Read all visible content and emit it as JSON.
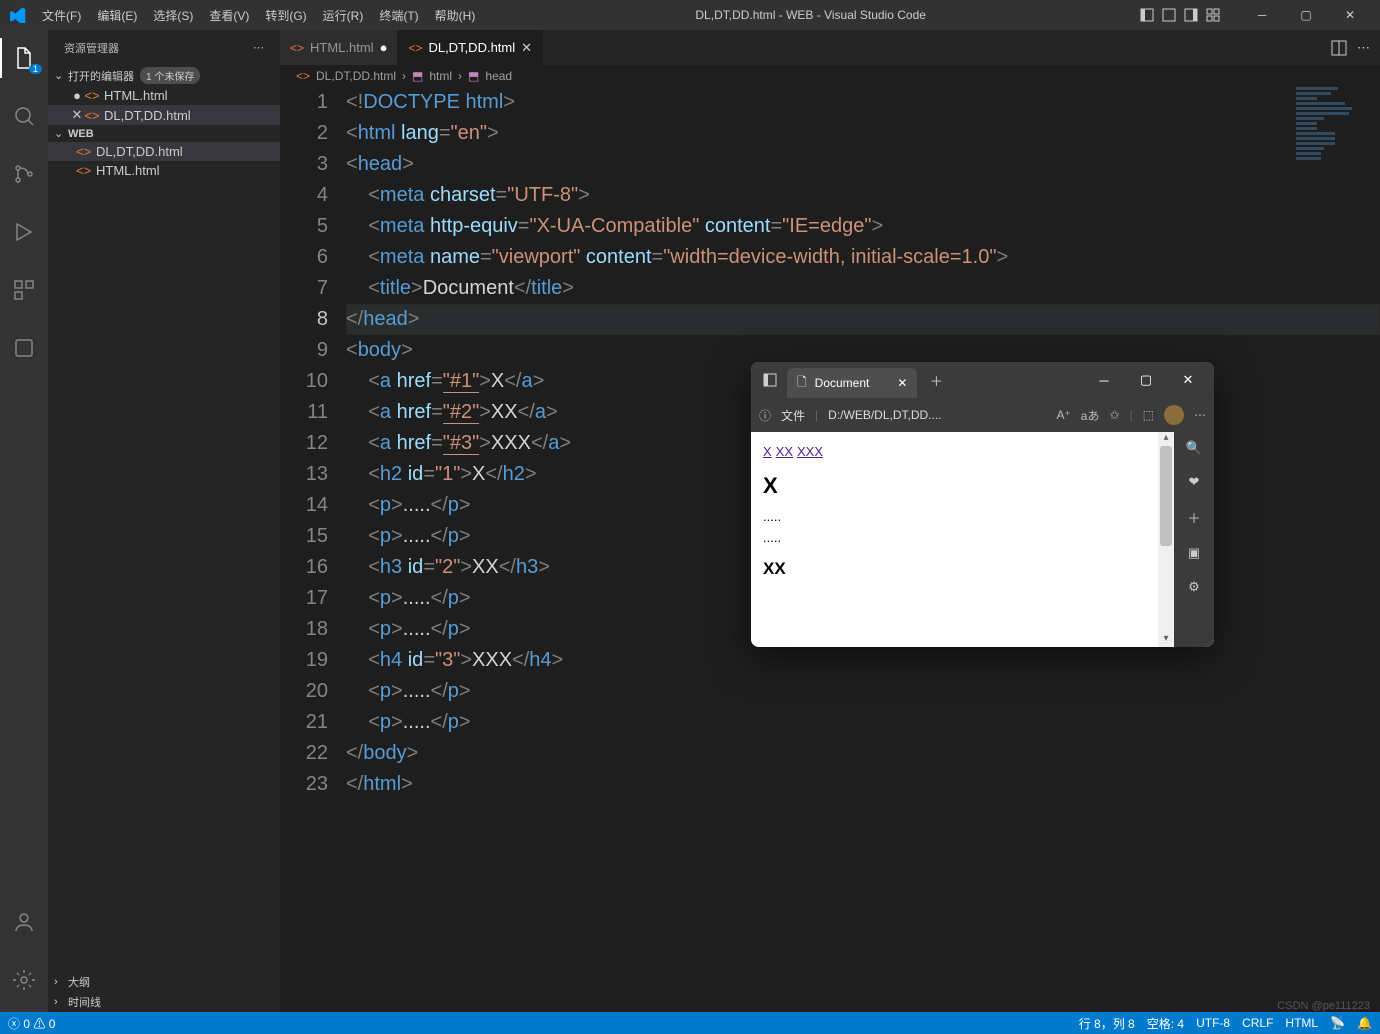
{
  "title": "DL,DT,DD.html - WEB - Visual Studio Code",
  "menu": [
    "文件(F)",
    "编辑(E)",
    "选择(S)",
    "查看(V)",
    "转到(G)",
    "运行(R)",
    "终端(T)",
    "帮助(H)"
  ],
  "sidebar": {
    "title": "资源管理器",
    "open_editors": {
      "label": "打开的编辑器",
      "badge": "1 个未保存",
      "items": [
        {
          "name": "HTML.html",
          "dirty": true,
          "active": false
        },
        {
          "name": "DL,DT,DD.html",
          "dirty": false,
          "active": true
        }
      ]
    },
    "folder": {
      "name": "WEB",
      "items": [
        {
          "name": "DL,DT,DD.html",
          "sel": true
        },
        {
          "name": "HTML.html",
          "sel": false
        }
      ]
    },
    "outline": "大纲",
    "timeline": "时间线"
  },
  "tabs": [
    {
      "name": "HTML.html",
      "dirty": true,
      "active": false
    },
    {
      "name": "DL,DT,DD.html",
      "dirty": false,
      "active": true
    }
  ],
  "breadcrumb": {
    "file": "DL,DT,DD.html",
    "path": [
      "html",
      "head"
    ]
  },
  "code": [
    [
      [
        "br",
        "<!"
      ],
      [
        "doctype",
        "DOCTYPE html"
      ],
      [
        "br",
        ">"
      ]
    ],
    [
      [
        "br",
        "<"
      ],
      [
        "tag",
        "html "
      ],
      [
        "attr",
        "lang"
      ],
      [
        "br",
        "="
      ],
      [
        "str",
        "\"en\""
      ],
      [
        "br",
        ">"
      ]
    ],
    [
      [
        "br",
        "<"
      ],
      [
        "tag",
        "head"
      ],
      [
        "br",
        ">"
      ]
    ],
    [
      [
        "ind",
        1
      ],
      [
        "br",
        "<"
      ],
      [
        "tag",
        "meta "
      ],
      [
        "attr",
        "charset"
      ],
      [
        "br",
        "="
      ],
      [
        "str",
        "\"UTF-8\""
      ],
      [
        "br",
        ">"
      ]
    ],
    [
      [
        "ind",
        1
      ],
      [
        "br",
        "<"
      ],
      [
        "tag",
        "meta "
      ],
      [
        "attr",
        "http-equiv"
      ],
      [
        "br",
        "="
      ],
      [
        "str",
        "\"X-UA-Compatible\""
      ],
      [
        "tag",
        " "
      ],
      [
        "attr",
        "content"
      ],
      [
        "br",
        "="
      ],
      [
        "str",
        "\"IE=edge\""
      ],
      [
        "br",
        ">"
      ]
    ],
    [
      [
        "ind",
        1
      ],
      [
        "br",
        "<"
      ],
      [
        "tag",
        "meta "
      ],
      [
        "attr",
        "name"
      ],
      [
        "br",
        "="
      ],
      [
        "str",
        "\"viewport\""
      ],
      [
        "tag",
        " "
      ],
      [
        "attr",
        "content"
      ],
      [
        "br",
        "="
      ],
      [
        "str",
        "\"width=device-width, initial-scale=1.0\""
      ],
      [
        "br",
        ">"
      ]
    ],
    [
      [
        "ind",
        1
      ],
      [
        "br",
        "<"
      ],
      [
        "tag",
        "title"
      ],
      [
        "br",
        ">"
      ],
      [
        "txt",
        "Document"
      ],
      [
        "br",
        "</"
      ],
      [
        "tag",
        "title"
      ],
      [
        "br",
        ">"
      ]
    ],
    [
      [
        "br",
        "</"
      ],
      [
        "tag",
        "head"
      ],
      [
        "br",
        ">"
      ]
    ],
    [
      [
        "br",
        "<"
      ],
      [
        "tag",
        "body"
      ],
      [
        "br",
        ">"
      ]
    ],
    [
      [
        "ind",
        1
      ],
      [
        "br",
        "<"
      ],
      [
        "tag",
        "a "
      ],
      [
        "attr",
        "href"
      ],
      [
        "br",
        "="
      ],
      [
        "strU",
        "\"#1\""
      ],
      [
        "br",
        ">"
      ],
      [
        "txt",
        "X"
      ],
      [
        "br",
        "</"
      ],
      [
        "tag",
        "a"
      ],
      [
        "br",
        ">"
      ]
    ],
    [
      [
        "ind",
        1
      ],
      [
        "br",
        "<"
      ],
      [
        "tag",
        "a "
      ],
      [
        "attr",
        "href"
      ],
      [
        "br",
        "="
      ],
      [
        "strU",
        "\"#2\""
      ],
      [
        "br",
        ">"
      ],
      [
        "txt",
        "XX"
      ],
      [
        "br",
        "</"
      ],
      [
        "tag",
        "a"
      ],
      [
        "br",
        ">"
      ]
    ],
    [
      [
        "ind",
        1
      ],
      [
        "br",
        "<"
      ],
      [
        "tag",
        "a "
      ],
      [
        "attr",
        "href"
      ],
      [
        "br",
        "="
      ],
      [
        "strU",
        "\"#3\""
      ],
      [
        "br",
        ">"
      ],
      [
        "txt",
        "XXX"
      ],
      [
        "br",
        "</"
      ],
      [
        "tag",
        "a"
      ],
      [
        "br",
        ">"
      ]
    ],
    [
      [
        "ind",
        1
      ],
      [
        "br",
        "<"
      ],
      [
        "tag",
        "h2 "
      ],
      [
        "attr",
        "id"
      ],
      [
        "br",
        "="
      ],
      [
        "str",
        "\"1\""
      ],
      [
        "br",
        ">"
      ],
      [
        "txt",
        "X"
      ],
      [
        "br",
        "</"
      ],
      [
        "tag",
        "h2"
      ],
      [
        "br",
        ">"
      ]
    ],
    [
      [
        "ind",
        1
      ],
      [
        "br",
        "<"
      ],
      [
        "tag",
        "p"
      ],
      [
        "br",
        ">"
      ],
      [
        "txt",
        "....."
      ],
      [
        "br",
        "</"
      ],
      [
        "tag",
        "p"
      ],
      [
        "br",
        ">"
      ]
    ],
    [
      [
        "ind",
        1
      ],
      [
        "br",
        "<"
      ],
      [
        "tag",
        "p"
      ],
      [
        "br",
        ">"
      ],
      [
        "txt",
        "....."
      ],
      [
        "br",
        "</"
      ],
      [
        "tag",
        "p"
      ],
      [
        "br",
        ">"
      ]
    ],
    [
      [
        "ind",
        1
      ],
      [
        "br",
        "<"
      ],
      [
        "tag",
        "h3 "
      ],
      [
        "attr",
        "id"
      ],
      [
        "br",
        "="
      ],
      [
        "str",
        "\"2\""
      ],
      [
        "br",
        ">"
      ],
      [
        "txt",
        "XX"
      ],
      [
        "br",
        "</"
      ],
      [
        "tag",
        "h3"
      ],
      [
        "br",
        ">"
      ]
    ],
    [
      [
        "ind",
        1
      ],
      [
        "br",
        "<"
      ],
      [
        "tag",
        "p"
      ],
      [
        "br",
        ">"
      ],
      [
        "txt",
        "....."
      ],
      [
        "br",
        "</"
      ],
      [
        "tag",
        "p"
      ],
      [
        "br",
        ">"
      ]
    ],
    [
      [
        "ind",
        1
      ],
      [
        "br",
        "<"
      ],
      [
        "tag",
        "p"
      ],
      [
        "br",
        ">"
      ],
      [
        "txt",
        "....."
      ],
      [
        "br",
        "</"
      ],
      [
        "tag",
        "p"
      ],
      [
        "br",
        ">"
      ]
    ],
    [
      [
        "ind",
        1
      ],
      [
        "br",
        "<"
      ],
      [
        "tag",
        "h4 "
      ],
      [
        "attr",
        "id"
      ],
      [
        "br",
        "="
      ],
      [
        "str",
        "\"3\""
      ],
      [
        "br",
        ">"
      ],
      [
        "txt",
        "XXX"
      ],
      [
        "br",
        "</"
      ],
      [
        "tag",
        "h4"
      ],
      [
        "br",
        ">"
      ]
    ],
    [
      [
        "ind",
        1
      ],
      [
        "br",
        "<"
      ],
      [
        "tag",
        "p"
      ],
      [
        "br",
        ">"
      ],
      [
        "txt",
        "....."
      ],
      [
        "br",
        "</"
      ],
      [
        "tag",
        "p"
      ],
      [
        "br",
        ">"
      ]
    ],
    [
      [
        "ind",
        1
      ],
      [
        "br",
        "<"
      ],
      [
        "tag",
        "p"
      ],
      [
        "br",
        ">"
      ],
      [
        "txt",
        "....."
      ],
      [
        "br",
        "</"
      ],
      [
        "tag",
        "p"
      ],
      [
        "br",
        ">"
      ]
    ],
    [
      [
        "br",
        "</"
      ],
      [
        "tag",
        "body"
      ],
      [
        "br",
        ">"
      ]
    ],
    [
      [
        "br",
        "</"
      ],
      [
        "tag",
        "html"
      ],
      [
        "br",
        ">"
      ]
    ]
  ],
  "current_line": 8,
  "status": {
    "errors": "0",
    "warnings": "0",
    "line": "行 8，列 8",
    "spaces": "空格: 4",
    "enc": "UTF-8",
    "eol": "CRLF",
    "lang": "HTML"
  },
  "browser": {
    "tab": "Document",
    "addr_label": "文件",
    "addr": "D:/WEB/DL,DT,DD....",
    "links": [
      "X",
      "XX",
      "XXX"
    ],
    "h2": "X",
    "p": ".....",
    "h3": "XX"
  },
  "watermark": "CSDN @pe111223"
}
